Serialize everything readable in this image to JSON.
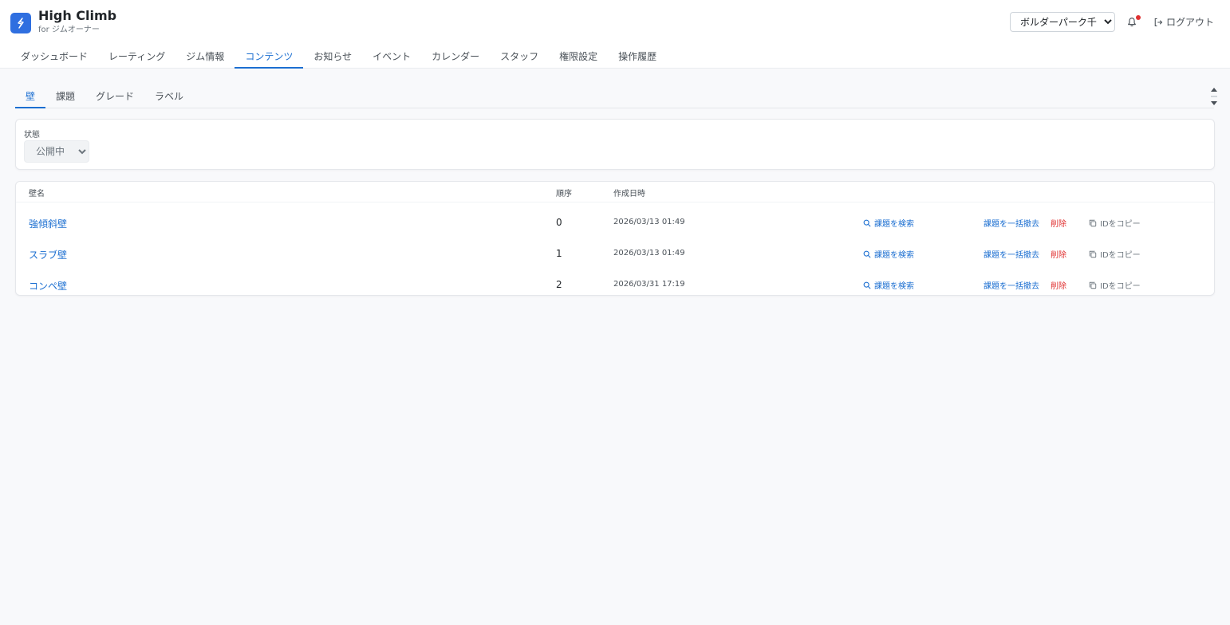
{
  "brand": {
    "title": "High Climb",
    "subtitle": "for ジムオーナー"
  },
  "header": {
    "gym_selected": "ボルダーパーク千葉",
    "logout_label": "ログアウト"
  },
  "main_tabs": [
    {
      "label": "ダッシュボード",
      "active": false
    },
    {
      "label": "レーティング",
      "active": false
    },
    {
      "label": "ジム情報",
      "active": false
    },
    {
      "label": "コンテンツ",
      "active": true
    },
    {
      "label": "お知らせ",
      "active": false
    },
    {
      "label": "イベント",
      "active": false
    },
    {
      "label": "カレンダー",
      "active": false
    },
    {
      "label": "スタッフ",
      "active": false
    },
    {
      "label": "権限設定",
      "active": false
    },
    {
      "label": "操作履歴",
      "active": false
    }
  ],
  "sub_tabs": [
    {
      "label": "壁",
      "active": true
    },
    {
      "label": "課題",
      "active": false
    },
    {
      "label": "グレード",
      "active": false
    },
    {
      "label": "ラベル",
      "active": false
    }
  ],
  "filter": {
    "status_label": "状態",
    "status_selected": "公開中"
  },
  "table": {
    "headers": {
      "name": "壁名",
      "order": "順序",
      "created": "作成日時"
    },
    "actions": {
      "search": "課題を検索",
      "withdraw": "課題を一括撤去",
      "delete": "削除",
      "copy": "IDをコピー"
    },
    "rows": [
      {
        "name": "強傾斜壁",
        "order": "0",
        "created": "2026/03/13 01:49"
      },
      {
        "name": "スラブ壁",
        "order": "1",
        "created": "2026/03/13 01:49"
      },
      {
        "name": "コンペ壁",
        "order": "2",
        "created": "2026/03/31 17:19"
      }
    ]
  },
  "colors": {
    "accent": "#1c6fd1",
    "brand": "#2f6fe0",
    "danger": "#e03131",
    "notification_dot": "#e03131"
  },
  "icons": {
    "logo": "lightning-bolt-icon",
    "bell": "bell-icon",
    "logout": "logout-icon",
    "search": "search-icon",
    "copy": "copy-icon"
  }
}
